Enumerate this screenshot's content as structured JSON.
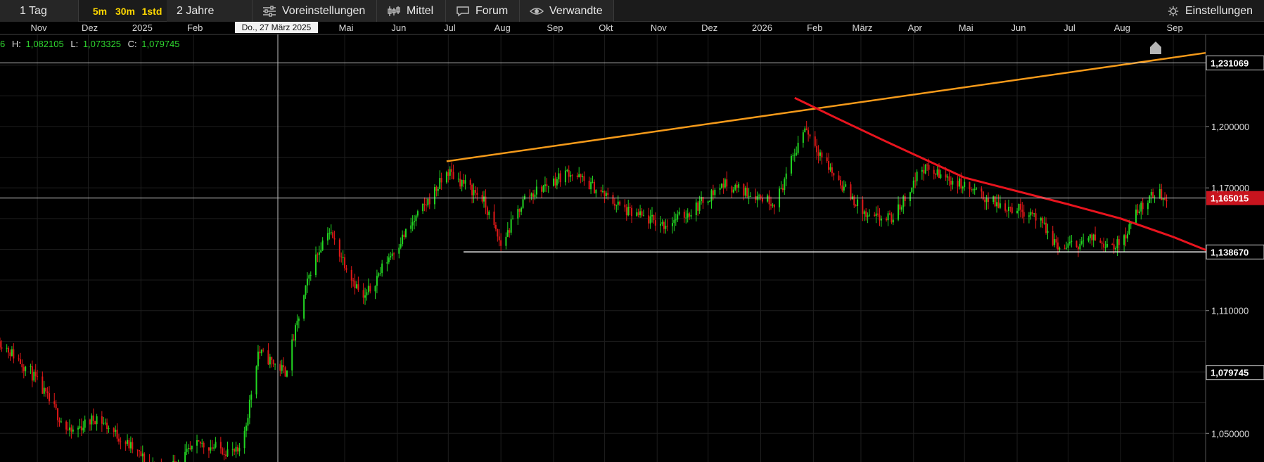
{
  "toolbar": {
    "interval": "1 Tag",
    "timeframes": [
      "5m",
      "30m",
      "1std"
    ],
    "range": "2 Jahre",
    "presets": "Voreinstellungen",
    "average": "Mittel",
    "forum": "Forum",
    "related": "Verwandte",
    "settings": "Einstellungen",
    "icons": [
      "sliders-icon",
      "candles-icon",
      "speech-bubble-icon",
      "eye-icon",
      "gear-icon"
    ],
    "timeframe_color": "#ffd800"
  },
  "crosshair": {
    "date_label": "Do., 27 März 2025"
  },
  "ohlc": {
    "open_fragment": "6",
    "h_label": "H:",
    "h_value": "1,082105",
    "l_label": "L:",
    "l_value": "1,073325",
    "c_label": "C:",
    "c_value": "1,079745"
  },
  "chart_data": {
    "type": "candlestick",
    "x_labels": [
      "Nov",
      "Dez",
      "2025",
      "Feb",
      "Mai",
      "Jun",
      "Jul",
      "Aug",
      "Sep",
      "Okt",
      "Nov",
      "Dez",
      "2026",
      "Feb",
      "März",
      "Apr",
      "Mai",
      "Jun",
      "Jul",
      "Aug",
      "Sep"
    ],
    "ylim": [
      1.036,
      1.245
    ],
    "y_ticks": [
      "1,200000",
      "1,170000",
      "1,110000",
      "1,050000"
    ],
    "price_markers": [
      {
        "value": 1.231069,
        "label": "1,231069",
        "style": "boxed"
      },
      {
        "value": 1.165015,
        "label": "1,165015",
        "style": "current"
      },
      {
        "value": 1.13867,
        "label": "1,138670",
        "style": "boxed"
      },
      {
        "value": 1.079745,
        "label": "1,079745",
        "style": "boxed"
      }
    ],
    "grid": true,
    "colors": {
      "up": "#22d622",
      "down": "#e01818",
      "resistance": "#f59a1a",
      "downtrend": "#e8141e",
      "current": "#c8141e"
    },
    "anchors": [
      [
        "2024-10-10",
        1.095
      ],
      [
        "2024-10-28",
        1.08
      ],
      [
        "2024-11-20",
        1.05
      ],
      [
        "2024-12-06",
        1.058
      ],
      [
        "2025-01-13",
        1.03
      ],
      [
        "2025-02-05",
        1.045
      ],
      [
        "2025-02-28",
        1.04
      ],
      [
        "2025-03-04",
        1.055
      ],
      [
        "2025-03-11",
        1.09
      ],
      [
        "2025-03-27",
        1.08
      ],
      [
        "2025-04-11",
        1.13
      ],
      [
        "2025-04-21",
        1.15
      ],
      [
        "2025-05-02",
        1.132
      ],
      [
        "2025-05-12",
        1.115
      ],
      [
        "2025-05-26",
        1.135
      ],
      [
        "2025-06-12",
        1.155
      ],
      [
        "2025-07-01",
        1.178
      ],
      [
        "2025-07-21",
        1.165
      ],
      [
        "2025-08-01",
        1.142
      ],
      [
        "2025-08-15",
        1.165
      ],
      [
        "2025-09-10",
        1.178
      ],
      [
        "2025-09-25",
        1.17
      ],
      [
        "2025-10-15",
        1.158
      ],
      [
        "2025-11-05",
        1.152
      ],
      [
        "2025-11-20",
        1.158
      ],
      [
        "2025-12-10",
        1.172
      ],
      [
        "2026-01-10",
        1.163
      ],
      [
        "2026-01-27",
        1.2
      ],
      [
        "2026-02-10",
        1.18
      ],
      [
        "2026-03-05",
        1.155
      ],
      [
        "2026-03-20",
        1.155
      ],
      [
        "2026-04-06",
        1.18
      ],
      [
        "2026-04-28",
        1.172
      ],
      [
        "2026-05-20",
        1.162
      ],
      [
        "2026-06-10",
        1.158
      ],
      [
        "2026-06-26",
        1.14
      ],
      [
        "2026-07-15",
        1.145
      ],
      [
        "2026-07-31",
        1.142
      ],
      [
        "2026-08-12",
        1.16
      ],
      [
        "2026-08-22",
        1.168
      ],
      [
        "2026-08-28",
        1.165
      ]
    ],
    "trendlines": [
      {
        "name": "resistance",
        "points": [
          [
            "2025-06-30",
            1.183
          ],
          [
            "2026-09-20",
            1.236
          ]
        ]
      },
      {
        "name": "downtrend",
        "points": [
          [
            "2026-01-21",
            1.214
          ],
          [
            "2026-02-15",
            1.204
          ],
          [
            "2026-03-15",
            1.193
          ],
          [
            "2026-05-01",
            1.175
          ],
          [
            "2026-07-01",
            1.162
          ],
          [
            "2026-08-01",
            1.155
          ],
          [
            "2026-09-01",
            1.146
          ],
          [
            "2026-09-22",
            1.139
          ]
        ]
      },
      {
        "name": "support",
        "points": [
          [
            "2025-07-10",
            1.13867
          ],
          [
            "2026-09-22",
            1.13867
          ]
        ]
      }
    ]
  }
}
